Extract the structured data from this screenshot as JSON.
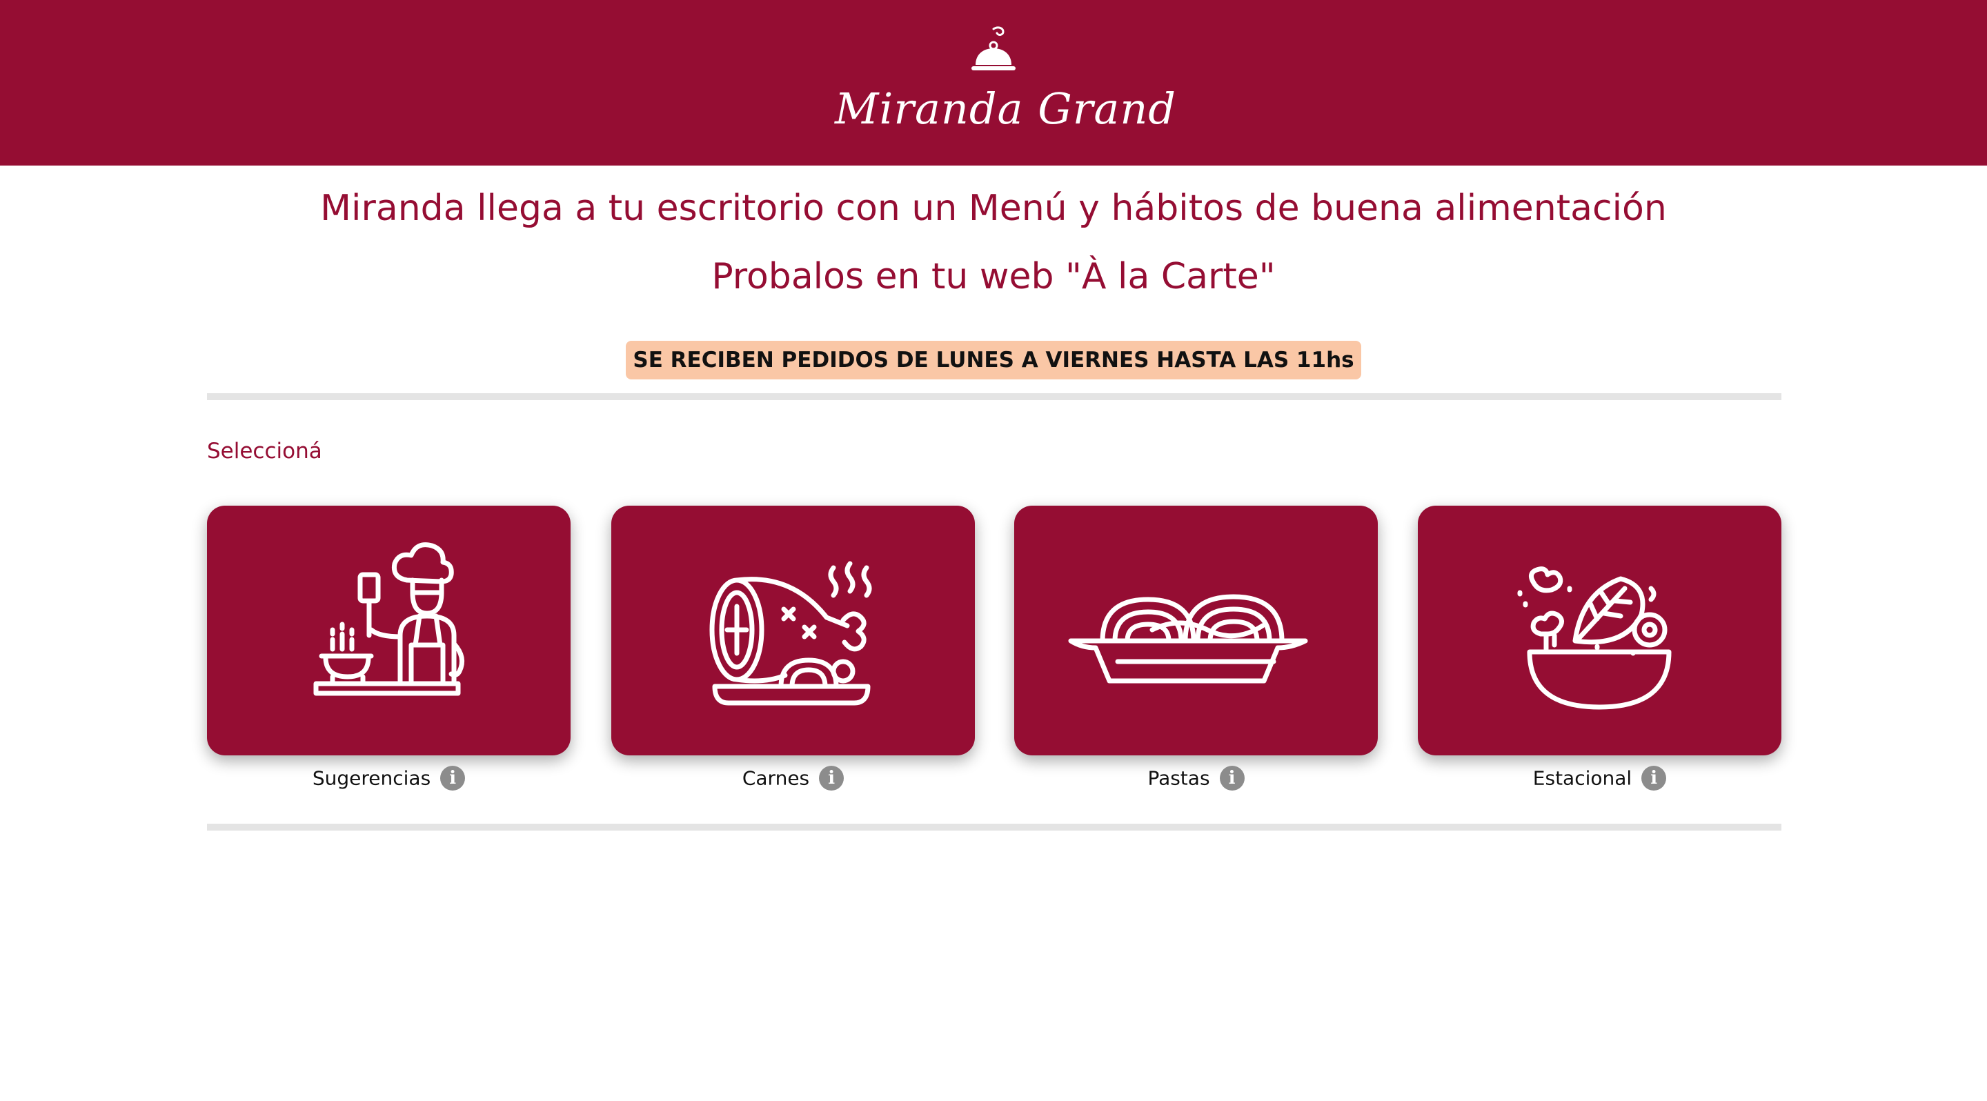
{
  "header": {
    "logo_text": "Miranda Grand",
    "brand_color": "#950d33"
  },
  "intro": {
    "line1": "Miranda llega a tu escritorio con un Menú y hábitos de buena alimentación",
    "line2": "Probalos en tu web \"À la Carte\""
  },
  "notice": {
    "text": "SE RECIBEN PEDIDOS DE LUNES A VIERNES HASTA LAS 11hs",
    "background": "#fac7a6"
  },
  "selection": {
    "label": "Seleccioná"
  },
  "categories": [
    {
      "label": "Sugerencias",
      "icon": "chef-icon",
      "info_icon": "i"
    },
    {
      "label": "Carnes",
      "icon": "ham-leg-icon",
      "info_icon": "i"
    },
    {
      "label": "Pastas",
      "icon": "spaghetti-plate-icon",
      "info_icon": "i"
    },
    {
      "label": "Estacional",
      "icon": "salad-bowl-icon",
      "info_icon": "i"
    }
  ]
}
